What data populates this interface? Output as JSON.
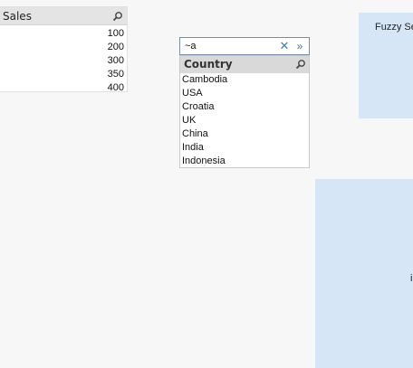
{
  "sales_listbox": {
    "title": "Sales",
    "values": [
      "100",
      "200",
      "300",
      "350",
      "400"
    ]
  },
  "search": {
    "value": "~a",
    "clear_label": "✕",
    "accept_label": "»"
  },
  "country_listbox": {
    "title": "Country",
    "items": [
      "Cambodia",
      "USA",
      "Croatia",
      "UK",
      "China",
      "India",
      "Indonesia"
    ]
  },
  "panels": {
    "top_text": "Fuzzy Se",
    "bottom_text": "i"
  },
  "icons": {
    "search": "search-icon",
    "clear": "close-icon",
    "accept": "double-chevron-right-icon"
  },
  "colors": {
    "panel_background": "#d6e6f7",
    "header_background": "#d9d9d9",
    "search_border": "#7b8ca8"
  }
}
